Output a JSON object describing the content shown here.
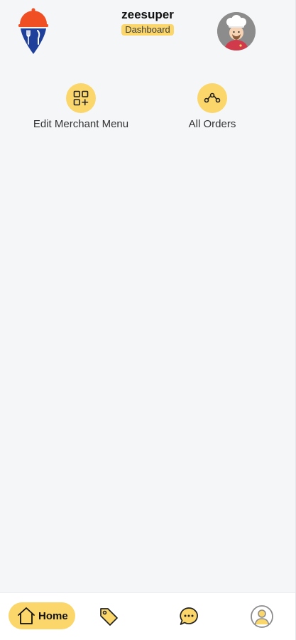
{
  "header": {
    "username": "zeesuper",
    "badge": "Dashboard"
  },
  "actions": [
    {
      "label": "Edit Merchant Menu",
      "icon": "qr-grid-icon"
    },
    {
      "label": "All Orders",
      "icon": "route-icon"
    }
  ],
  "bottom_nav": {
    "home_label": "Home",
    "items": [
      "home-icon",
      "tag-icon",
      "chat-icon",
      "profile-icon"
    ],
    "active": "Home"
  },
  "colors": {
    "accent": "#fbd66a",
    "background": "#f5f6f8",
    "logo_orange": "#f04e23",
    "logo_blue": "#1e3f9a"
  }
}
